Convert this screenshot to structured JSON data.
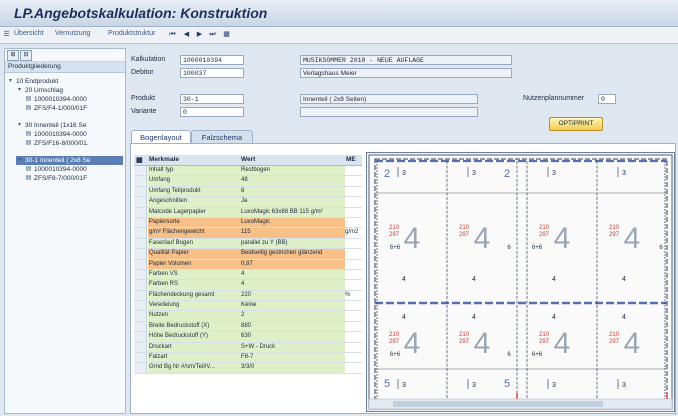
{
  "window": {
    "title": "LP.Angebotskalkulation: Konstruktion"
  },
  "toolbar": {
    "items": [
      "Übersicht",
      "Vernutzung",
      "Produktstruktur"
    ],
    "nav_icons": [
      "first-icon",
      "prev-icon",
      "next-icon",
      "last-icon",
      "grid-icon"
    ]
  },
  "tree": {
    "header": "Produktgliederung",
    "nodes": [
      {
        "label": "10 Endprodukt",
        "level": 0,
        "selected": false
      },
      {
        "label": "20 Umschlag",
        "level": 1,
        "selected": false
      },
      {
        "label": "1000010394-0000",
        "level": 2,
        "selected": false
      },
      {
        "label": "ZFS/F4-1/000/01F",
        "level": 2,
        "selected": false
      },
      {
        "label": "30 Innenteil (1x16 Se",
        "level": 1,
        "selected": false
      },
      {
        "label": "1000010394-0000",
        "level": 2,
        "selected": false
      },
      {
        "label": "ZFS/F16-8/000/01.",
        "level": 2,
        "selected": false
      },
      {
        "label": "30-1 Innenteil ( 2x8 Se",
        "level": 1,
        "selected": true
      },
      {
        "label": "1000010394-0000",
        "level": 2,
        "selected": false
      },
      {
        "label": "ZFS/F8-7/000/01F",
        "level": 2,
        "selected": false
      }
    ]
  },
  "form": {
    "kalkulation_label": "Kalkulation",
    "kalkulation_value": "1000010394",
    "debitor_label": "Debitor",
    "debitor_value": "100037",
    "title_value": "MUSIKSOMMER 2010 - NEUE AUFLAGE",
    "customer_value": "Verlagshaus Meier",
    "produkt_label": "Produkt",
    "produkt_value": "30-1",
    "variante_label": "Variante",
    "variante_value": "0",
    "produkt_desc": "Innenteil ( 2x8 Seiten)",
    "nutzen_label": "Nutzenplannummer",
    "nutzen_value": "0",
    "optiprint_label": "OPTIPRINT"
  },
  "tabs": [
    {
      "label": "Bogenlayout",
      "active": true
    },
    {
      "label": "Falzschema",
      "active": false
    }
  ],
  "properties": {
    "col_key": "Merkmale",
    "col_value": "Wert",
    "col_unit": "ME",
    "rows": [
      {
        "key": "Inhalt typ",
        "value": "Restbogen",
        "unit": "",
        "hl": "green"
      },
      {
        "key": "Umfang",
        "value": "48",
        "unit": "",
        "hl": "green"
      },
      {
        "key": "Umfang Teilprodukt",
        "value": "8",
        "unit": "",
        "hl": "green"
      },
      {
        "key": "Angeschnitten",
        "value": "Ja",
        "unit": "",
        "hl": "green"
      },
      {
        "key": "Matcode Lagerpapier",
        "value": "LuxoMagic 63x88 BB 115 g/m²",
        "unit": "",
        "hl": "green"
      },
      {
        "key": "Papiersorte",
        "value": "LuxoMagic",
        "unit": "",
        "hl": "orange"
      },
      {
        "key": "g/m² Flächengewicht",
        "value": "115",
        "unit": "g/m2",
        "hl": "orange"
      },
      {
        "key": "Faserlauf Bogen",
        "value": "parallel zu Y (BB)",
        "unit": "",
        "hl": "green"
      },
      {
        "key": "Qualität Papier",
        "value": "Beidseitig gestrichen glänzend",
        "unit": "",
        "hl": "orange"
      },
      {
        "key": "Papier Volumen",
        "value": "0,87",
        "unit": "",
        "hl": "orange"
      },
      {
        "key": "Farben VS",
        "value": "4",
        "unit": "",
        "hl": "green"
      },
      {
        "key": "Farben RS",
        "value": "4",
        "unit": "",
        "hl": "green"
      },
      {
        "key": "Flächendeckung gesamt",
        "value": "220",
        "unit": "%",
        "hl": "green"
      },
      {
        "key": "Veredelung",
        "value": "Keine",
        "unit": "",
        "hl": "green"
      },
      {
        "key": "Nutzen",
        "value": "2",
        "unit": "",
        "hl": "green"
      },
      {
        "key": "Breite Bedruckstoff (X)",
        "value": "880",
        "unit": "",
        "hl": "green"
      },
      {
        "key": "Höhe Bedruckstoff (Y)",
        "value": "630",
        "unit": "",
        "hl": "green"
      },
      {
        "key": "Druckart",
        "value": "S+W - Druck",
        "unit": "",
        "hl": "green"
      },
      {
        "key": "Falzart",
        "value": "F8-7",
        "unit": "",
        "hl": "green"
      },
      {
        "key": "Grnd Bg Nr #/sm/Teil/V...",
        "value": "3/3/0",
        "unit": "",
        "hl": "green"
      }
    ]
  },
  "sheet": {
    "page_big": "4",
    "page_small_top": "3",
    "page_small_mid": "4",
    "page_small_bot": "3",
    "mark_side": "2",
    "mark_alt": "5",
    "dim_top": "210",
    "dim_bot": "297",
    "dim_bb": "6+6",
    "dim_edge": "6",
    "colors": {
      "red": "#d9332b",
      "blue": "#5a6fb0",
      "grid": "#2f3d55",
      "numeral": "#9aa6b4"
    }
  }
}
